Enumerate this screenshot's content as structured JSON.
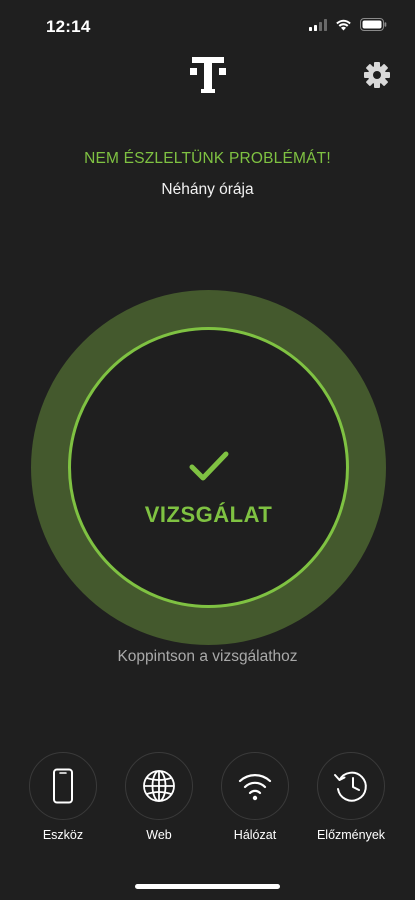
{
  "status_bar": {
    "time": "12:14"
  },
  "header": {
    "logo_icon": "telekom-t-logo-icon",
    "settings_icon": "gear-icon"
  },
  "scan_status": {
    "title": "NEM ÉSZLELTÜNK PROBLÉMÁT!",
    "subtitle": "Néhány órája"
  },
  "scan_button": {
    "label": "VIZSGÁLAT",
    "icon": "checkmark-icon",
    "hint": "Koppintson a vizsgálathoz"
  },
  "nav": {
    "items": [
      {
        "label": "Eszköz",
        "icon": "smartphone-icon"
      },
      {
        "label": "Web",
        "icon": "globe-icon"
      },
      {
        "label": "Hálózat",
        "icon": "wifi-icon"
      },
      {
        "label": "Előzmények",
        "icon": "history-icon"
      }
    ]
  },
  "colors": {
    "background": "#1f1f1f",
    "accent_green": "#7fc242",
    "ring_green": "#44592d",
    "hint_gray": "#a9a9a9"
  }
}
